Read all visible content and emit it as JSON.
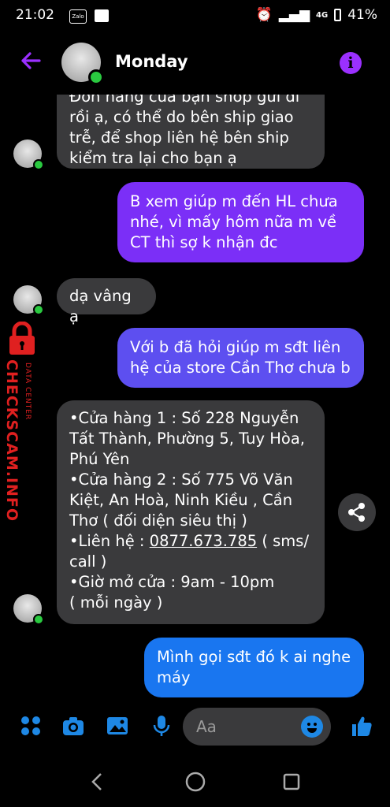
{
  "status": {
    "time": "21:02",
    "app_icon": "Zalo",
    "network": "4G",
    "battery": "41%"
  },
  "header": {
    "title": "Monday"
  },
  "messages": [
    {
      "dir": "in",
      "lines": [
        "Đơn hàng của bạn shop gửi đi",
        "rồi ạ, có thể do bên ship giao",
        "trễ, để shop liên hệ bên ship",
        "kiểm tra lại cho bạn ạ"
      ]
    },
    {
      "dir": "out",
      "lines": [
        "B xem giúp m đến HL chưa",
        "nhé, vì mấy hôm nữa m về",
        "CT thì sợ k nhận đc"
      ]
    },
    {
      "dir": "in",
      "lines": [
        "dạ vâng ạ"
      ]
    },
    {
      "dir": "out",
      "lines": [
        "Với b đã hỏi giúp m sđt liên",
        "hệ của store Cần Thơ chưa b"
      ]
    },
    {
      "dir": "in",
      "lines": [
        "•Cửa hàng 1 : Số 228 Nguyễn",
        "Tất Thành, Phường 5, Tuy Hòa,",
        "Phú Yên",
        "•Cửa hàng 2 : Số 775 Võ Văn",
        "Kiệt, An Hoà, Ninh Kiều , Cần",
        "Thơ ( đối diện siêu thị )",
        "•Liên hệ : ",
        "call )",
        "•Giờ mở cửa : 9am - 10pm",
        "( mỗi ngày )"
      ],
      "phone": "0877.673.785",
      "phone_suffix": " ( sms/"
    },
    {
      "dir": "out",
      "lines": [
        "Mình gọi sđt đó k ai nghe",
        "máy"
      ]
    }
  ],
  "watermark": {
    "brand": "CHECKSCAM.INFO",
    "sub": "DATA CENTER"
  },
  "composer": {
    "placeholder": "Aa"
  },
  "colors": {
    "accent_purple": "#9b30ff",
    "out_purple_top": "#7b2ff7",
    "out_blue": "#1976f0",
    "bubble_in": "#3a3a3c",
    "online": "#2ac940"
  }
}
